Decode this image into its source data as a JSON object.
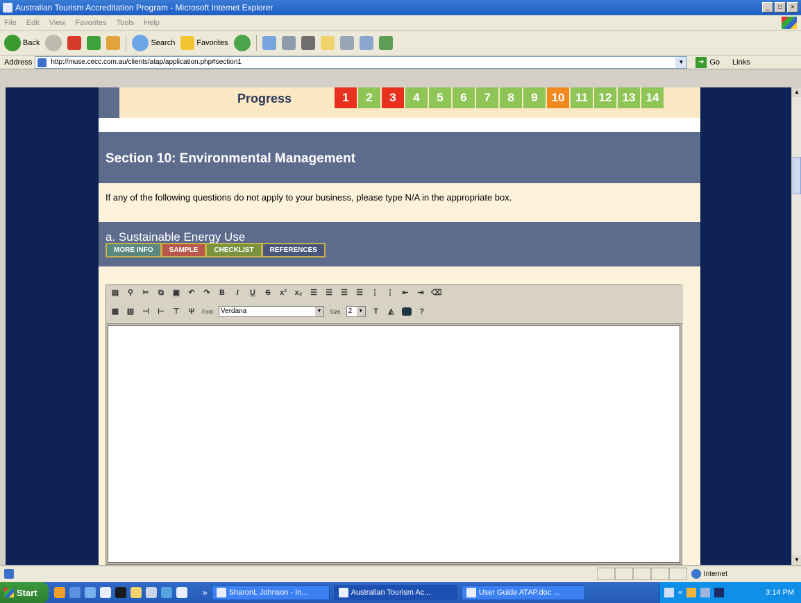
{
  "window": {
    "title": "Australian Tourism Accreditation Program - Microsoft Internet Explorer",
    "controls": [
      "_",
      "□",
      "×"
    ]
  },
  "menu": [
    "File",
    "Edit",
    "View",
    "Favorites",
    "Tools",
    "Help"
  ],
  "toolbar": {
    "back_label": "Back",
    "search_label": "Search",
    "favorites_label": "Favorites"
  },
  "address": {
    "label": "Address",
    "url": "http://muse.cecc.com.au/clients/atap/application.php#section1",
    "go_label": "Go",
    "links_label": "Links"
  },
  "progress": {
    "label": "Progress",
    "cells": [
      {
        "num": "1",
        "color": "#e8321f"
      },
      {
        "num": "2",
        "color": "#8fc557"
      },
      {
        "num": "3",
        "color": "#e8321f"
      },
      {
        "num": "4",
        "color": "#8fc557"
      },
      {
        "num": "5",
        "color": "#8fc557"
      },
      {
        "num": "6",
        "color": "#8fc557"
      },
      {
        "num": "7",
        "color": "#8fc557"
      },
      {
        "num": "8",
        "color": "#8fc557"
      },
      {
        "num": "9",
        "color": "#8fc557"
      },
      {
        "num": "10",
        "color": "#f08a1e"
      },
      {
        "num": "11",
        "color": "#8fc557"
      },
      {
        "num": "12",
        "color": "#8fc557"
      },
      {
        "num": "13",
        "color": "#8fc557"
      },
      {
        "num": "14",
        "color": "#8fc557"
      }
    ]
  },
  "section": {
    "title": "Section 10: Environmental Management",
    "instruction": "If any of the following questions do not apply to your business, please type N/A in the appropriate box."
  },
  "subsection": {
    "title": "a. Sustainable Energy Use",
    "buttons": {
      "more_info": "MORE INFO",
      "sample": "SAMPLE",
      "checklist": "CHECKLIST",
      "references": "REFERENCES"
    }
  },
  "editor": {
    "font_label": "Font",
    "font_value": "Verdana",
    "size_label": "Size",
    "size_value": "2"
  },
  "status": {
    "zone": "Internet"
  },
  "taskbar": {
    "start_label": "Start",
    "tasks": [
      "SharonL Johnson - In...",
      "Australian Tourism Ac...",
      "User Guide ATAP.doc ..."
    ],
    "clock": "3:14 PM"
  },
  "colors": {
    "navy_bg": "#0e2255",
    "band": "#5d6b8d",
    "cream": "#fdf3dc"
  }
}
